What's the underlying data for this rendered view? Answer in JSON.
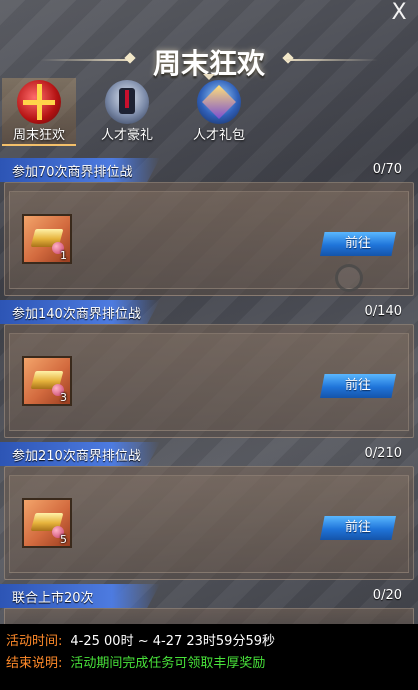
{
  "header": {
    "title": "周末狂欢",
    "close_label": "X"
  },
  "tabs": [
    {
      "label": "周末狂欢",
      "icon": "gift-box-icon",
      "active": true
    },
    {
      "label": "人才豪礼",
      "icon": "suit-icon",
      "active": false
    },
    {
      "label": "人才礼包",
      "icon": "cube-pack-icon",
      "active": false
    }
  ],
  "tasks": [
    {
      "title": "参加70次商界排位战",
      "progress": "0/70",
      "item_count": "1",
      "button_label": "前往"
    },
    {
      "title": "参加140次商界排位战",
      "progress": "0/140",
      "item_count": "3",
      "button_label": "前往"
    },
    {
      "title": "参加210次商界排位战",
      "progress": "0/210",
      "item_count": "5",
      "button_label": "前往"
    },
    {
      "title": "联合上市20次",
      "progress": "0/20"
    }
  ],
  "footer": {
    "time_label": "活动时间:",
    "time_value": "4-25 00时 ~ 4-27 23时59分59秒",
    "desc_label": "结束说明:",
    "desc_value": "活动期间完成任务可领取丰厚奖励"
  },
  "colors": {
    "accent_blue": "#2d55b5",
    "footer_label": "#ff8a2a",
    "footer_green": "#48e23a"
  }
}
